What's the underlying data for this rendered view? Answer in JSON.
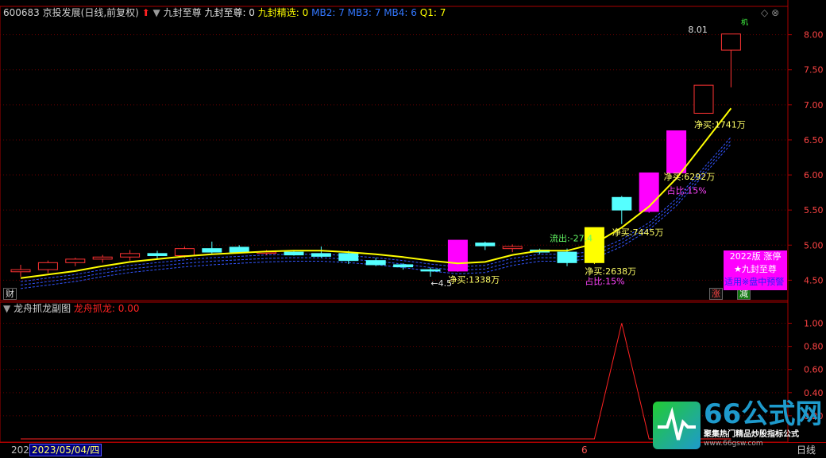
{
  "header": {
    "code": "600683",
    "name_period": "京投发展(日线,前复权)",
    "indicator_name": "九封至尊",
    "indicator_value_label": "九封至尊: 0",
    "jiufeng_select": "九封精选: 0",
    "mb2": "MB2: 7",
    "mb3": "MB3: 7",
    "mb4": "MB4: 6",
    "q1": "Q1: 7"
  },
  "price_axis": {
    "ticks": [
      "8.00",
      "7.50",
      "7.00",
      "6.50",
      "6.00",
      "5.50",
      "5.00",
      "4.50"
    ],
    "values": [
      8.0,
      7.5,
      7.0,
      6.5,
      6.0,
      5.5,
      5.0,
      4.5
    ]
  },
  "price_annotations": [
    {
      "text": "8.01",
      "color": "#e0e0e0"
    },
    {
      "text": "←4.5",
      "color": "#e0e0e0"
    },
    {
      "text": "净买:1338万",
      "color": "#ffff66"
    },
    {
      "text": "流出:-27.4",
      "color": "#66ff66"
    },
    {
      "text": "净买:2638万",
      "color": "#ffff66"
    },
    {
      "text": "占比:15%",
      "color": "#ff44ff"
    },
    {
      "text": "净买:7445万",
      "color": "#ffff66"
    },
    {
      "text": "净买:6292万",
      "color": "#ffff66"
    },
    {
      "text": "占比:15%",
      "color": "#ff44ff"
    },
    {
      "text": "净买:1741万",
      "color": "#ffff66"
    }
  ],
  "promo_box": {
    "line1": "2022版 涨停",
    "line2": "★九封至尊",
    "line3": "适用※盘中预警"
  },
  "markers": {
    "cai": "财",
    "zhang": "涨",
    "jian": "减",
    "top_tag": "机"
  },
  "sub_header": {
    "title": "龙舟抓龙副图",
    "value_label": "龙舟抓龙: 0.00"
  },
  "sub_axis": {
    "ticks": [
      "1.00",
      "0.80",
      "0.60",
      "0.40",
      "0.20"
    ],
    "values": [
      1.0,
      0.8,
      0.6,
      0.4,
      0.2
    ]
  },
  "bottom_bar": {
    "year_prefix": "202",
    "date": "2023/05/04/四",
    "marker": "6",
    "period": "日线"
  },
  "watermark": {
    "brand": "66公式网",
    "slogan": "聚集热门精品炒股指标公式",
    "url": "www.66gsw.com"
  },
  "colors": {
    "up": "#ff3333",
    "down": "#55ffff",
    "limit_up": "#ff00ff",
    "yellow_candle": "#ffff00",
    "ma_line": "#ffff00",
    "band_line": "#3355ff",
    "sub_line": "#ff2222"
  },
  "chart_data": {
    "type": "candlestick",
    "series_ohlc": [
      [
        4.62,
        4.72,
        4.55,
        4.65
      ],
      [
        4.65,
        4.78,
        4.6,
        4.75
      ],
      [
        4.75,
        4.82,
        4.7,
        4.8
      ],
      [
        4.8,
        4.86,
        4.75,
        4.83
      ],
      [
        4.83,
        4.93,
        4.78,
        4.88
      ],
      [
        4.88,
        4.92,
        4.8,
        4.85
      ],
      [
        4.85,
        4.98,
        4.82,
        4.95
      ],
      [
        4.95,
        5.05,
        4.88,
        4.9
      ],
      [
        4.97,
        5.0,
        4.88,
        4.9
      ],
      [
        4.9,
        4.93,
        4.86,
        4.9
      ],
      [
        4.9,
        4.93,
        4.85,
        4.86
      ],
      [
        4.88,
        4.98,
        4.82,
        4.84
      ],
      [
        4.88,
        4.92,
        4.73,
        4.78
      ],
      [
        4.78,
        4.82,
        4.7,
        4.72
      ],
      [
        4.72,
        4.74,
        4.65,
        4.69
      ],
      [
        4.65,
        4.68,
        4.55,
        4.63
      ],
      [
        4.63,
        5.07,
        4.62,
        5.07
      ],
      [
        5.03,
        5.05,
        4.93,
        4.99
      ],
      [
        4.95,
        5.01,
        4.9,
        4.98
      ],
      [
        4.93,
        4.95,
        4.87,
        4.9
      ],
      [
        4.9,
        4.95,
        4.7,
        4.75
      ],
      [
        4.75,
        5.25,
        4.73,
        5.25
      ],
      [
        5.68,
        5.7,
        5.3,
        5.5
      ],
      [
        5.48,
        6.03,
        5.46,
        6.03
      ],
      [
        6.03,
        6.63,
        6.02,
        6.63
      ],
      [
        6.88,
        7.28,
        6.88,
        7.28
      ],
      [
        7.78,
        8.01,
        7.25,
        8.01
      ]
    ],
    "ma_values": [
      4.53,
      4.58,
      4.63,
      4.7,
      4.76,
      4.8,
      4.84,
      4.87,
      4.89,
      4.91,
      4.92,
      4.92,
      4.9,
      4.87,
      4.83,
      4.78,
      4.74,
      4.76,
      4.86,
      4.92,
      4.92,
      5.02,
      5.25,
      5.55,
      5.95,
      6.45,
      6.95
    ],
    "sub_values": [
      0,
      0,
      0,
      0,
      0,
      0,
      0,
      0,
      0,
      0,
      0,
      0,
      0,
      0,
      0,
      0,
      0,
      0,
      0,
      0,
      0,
      0,
      1.0,
      0,
      0,
      0,
      0
    ],
    "ylim": [
      4.3,
      8.2
    ],
    "sub_ylim": [
      0,
      1.1
    ]
  }
}
